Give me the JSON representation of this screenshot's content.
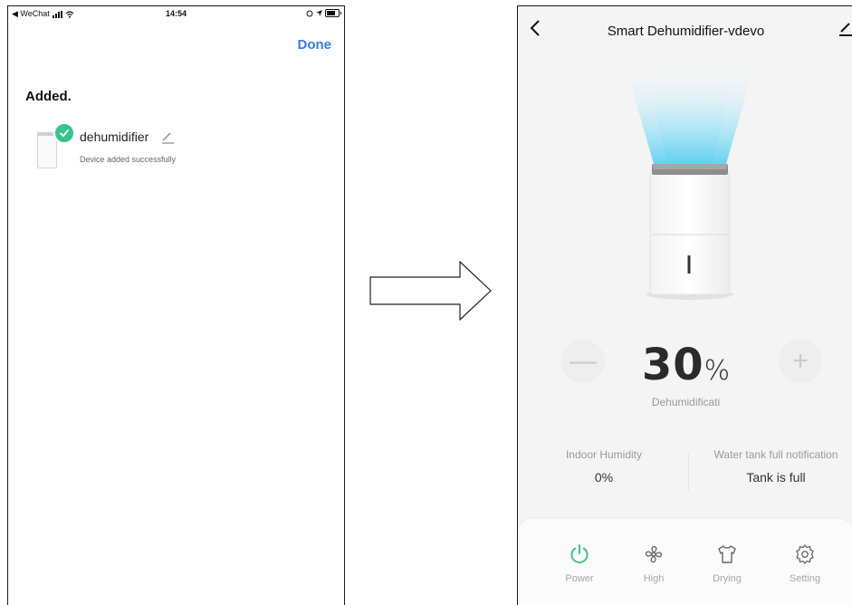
{
  "left_screen": {
    "status_bar": {
      "back_app": "◀ WeChat",
      "time": "14:54"
    },
    "done_label": "Done",
    "section_title": "Added.",
    "device": {
      "name": "dehumidifier",
      "status": "Device added successfully"
    }
  },
  "right_screen": {
    "title": "Smart Dehumidifier-vdevo",
    "target_value": "30",
    "target_unit": "%",
    "mode_label": "Dehumidificati",
    "indoor_humidity": {
      "label": "Indoor Humidity",
      "value": "0%"
    },
    "water_tank": {
      "label": "Water tank full notification",
      "value": "Tank is full"
    },
    "tabs": [
      {
        "label": "Power",
        "icon": "power-icon"
      },
      {
        "label": "High",
        "icon": "fan-icon"
      },
      {
        "label": "Drying",
        "icon": "shirt-icon"
      },
      {
        "label": "Setting",
        "icon": "gear-icon"
      }
    ]
  },
  "colors": {
    "accent_blue": "#3478f6",
    "success_green": "#36c48c",
    "power_green": "#3fc68a",
    "glow_blue": "#7fd9f2"
  }
}
